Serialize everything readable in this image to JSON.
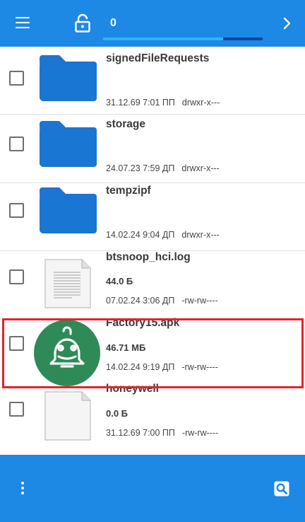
{
  "toolbar": {
    "count": "0",
    "progress_fraction": 0.75
  },
  "icons": {
    "menu": "menu-icon",
    "lock": "lock-open-icon",
    "next": "chevron-right-icon",
    "overflow": "more-vert-icon",
    "search": "search-icon"
  },
  "files": [
    {
      "name": "signedFileRequests",
      "size": "",
      "date": "31.12.69 7:01 ПП",
      "perm": "drwxr-x---",
      "type": "folder"
    },
    {
      "name": "storage",
      "size": "",
      "date": "24.07.23 7:59 ДП",
      "perm": "drwxr-x---",
      "type": "folder"
    },
    {
      "name": "tempzipf",
      "size": "",
      "date": "14.02.24 9:04 ДП",
      "perm": "drwxr-x---",
      "type": "folder"
    },
    {
      "name": "btsnoop_hci.log",
      "size": "44.0 Б",
      "date": "07.02.24 3:06 ДП",
      "perm": "-rw-rw----",
      "type": "text"
    },
    {
      "name": "Factory15.apk",
      "size": "46.71 МБ",
      "date": "14.02.24 9:19 ДП",
      "perm": "-rw-rw----",
      "type": "apk"
    },
    {
      "name": "honeywell",
      "size": "0.0 Б",
      "date": "31.12.69 7:00 ПП",
      "perm": "-rw-rw----",
      "type": "blank"
    }
  ],
  "colors": {
    "primary": "#1e88e5",
    "folder": "#1e74d2",
    "apk_bg": "#2e8a57",
    "highlight": "#e3232d"
  }
}
